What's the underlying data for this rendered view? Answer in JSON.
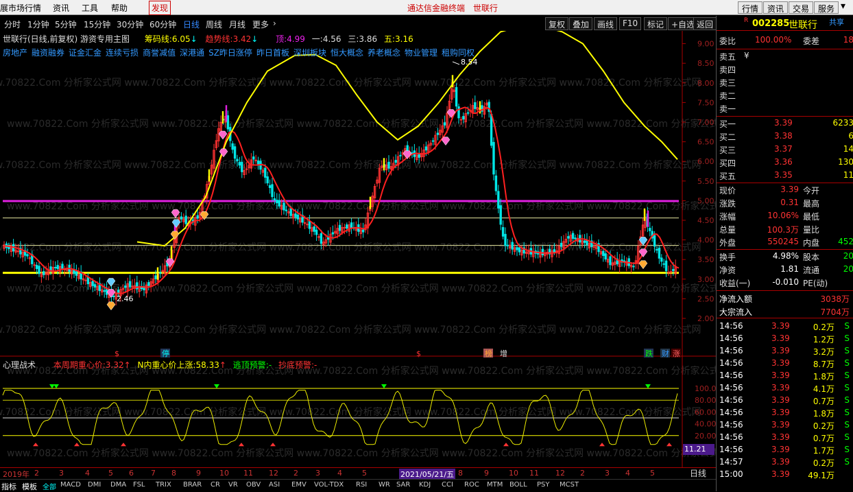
{
  "menu": {
    "items": [
      "展市场行情",
      "资讯",
      "工具",
      "帮助"
    ],
    "discover": "发现",
    "center_links": [
      "通达信金融终端",
      "世联行"
    ],
    "right_buttons": [
      "行情",
      "资讯",
      "交易",
      "服务"
    ]
  },
  "periods": {
    "items": [
      "分时",
      "1分钟",
      "5分钟",
      "15分钟",
      "30分钟",
      "60分钟",
      "日线",
      "周线",
      "月线",
      "更多"
    ],
    "active": "日线",
    "arrow": "›"
  },
  "toolbar": {
    "buttons": [
      "复权",
      "叠加",
      "画线",
      "F10",
      "标记",
      "+自选",
      "返回"
    ]
  },
  "main_chart": {
    "title": "世联行(日线,前复权)",
    "subtitle": "游资专用主图",
    "chip_line_label": "筹码线:",
    "chip_line_value": "6.05",
    "chip_arrow": "↓",
    "trend_line_label": "趋势线:",
    "trend_line_value": "3.42",
    "trend_arrow": "↓",
    "top_label": "顶:",
    "top_value": "4.99",
    "l1_label": "一:",
    "l1_value": "4.56",
    "l3_label": "三:",
    "l3_value": "3.86",
    "l5_label": "五:",
    "l5_value": "3.16",
    "tags": [
      "房地产",
      "融资融券",
      "证金汇金",
      "连续亏损",
      "商誉减值",
      "深港通",
      "SZ昨日涨停",
      "昨日首板",
      "深圳板块",
      "恒大概念",
      "养老概念",
      "物业管理",
      "租购同权"
    ],
    "price_axis": [
      "9.50",
      "9.00",
      "8.50",
      "8.00",
      "7.50",
      "7.00",
      "6.50",
      "6.00",
      "5.50",
      "5.00",
      "4.50",
      "4.00",
      "3.50",
      "3.00",
      "2.50",
      "2.00"
    ],
    "high_label": "8.54",
    "low_label": "2.46",
    "markers": [
      "$",
      "$",
      "榜",
      "增",
      "$",
      "跌",
      "财",
      "涨"
    ],
    "watermark": "www.70822.Com 分析家公式网"
  },
  "sub_chart": {
    "title": "心理战术",
    "week_label": "本周期重心价:",
    "week_value": "3.32",
    "week_arrow": "↑",
    "n_label": "N内重心价上涨:",
    "n_value": "58.33",
    "n_arrow": "↑",
    "escape_label": "逃顶预警:",
    "escape_value": "-",
    "bottom_label": "抄底预警:",
    "bottom_value": "-",
    "axis": [
      "100.0",
      "80.00",
      "60.00",
      "40.00",
      "20.00"
    ],
    "current": "11.21"
  },
  "date_axis": {
    "labels": [
      "2019年",
      "2",
      "3",
      "4",
      "5",
      "6",
      "7",
      "8",
      "9",
      "10",
      "11",
      "12",
      "2",
      "3",
      "4",
      "5",
      "2021/05/21/五",
      "8",
      "9",
      "10",
      "11",
      "12",
      "2",
      "3",
      "4",
      "5"
    ],
    "timeframe": "日线"
  },
  "indicator_tabs": {
    "prefix": [
      "指标",
      "模板"
    ],
    "items": [
      "全部",
      "MACD",
      "DMI",
      "DMA",
      "FSL",
      "TRIX",
      "BRAR",
      "CR",
      "VR",
      "OBV",
      "ASI",
      "EMV",
      "VOL-TDX",
      "RSI",
      "WR",
      "SAR",
      "KDJ",
      "CCI",
      "ROC",
      "MTM",
      "BOLL",
      "PSY",
      "MCST"
    ],
    "active": "全部"
  },
  "quote": {
    "badge": "R",
    "code": "002285",
    "name": "世联行",
    "share": "共享",
    "weibi_label": "委比",
    "weibi": "100.00%",
    "weicha_label": "委差",
    "weicha": "18",
    "sell": [
      {
        "label": "卖五",
        "price": "¥",
        "vol": ""
      },
      {
        "label": "卖四",
        "price": "",
        "vol": ""
      },
      {
        "label": "卖三",
        "price": "",
        "vol": ""
      },
      {
        "label": "卖二",
        "price": "",
        "vol": ""
      },
      {
        "label": "卖一",
        "price": "",
        "vol": ""
      }
    ],
    "buy": [
      {
        "label": "买一",
        "price": "3.39",
        "vol": "6233"
      },
      {
        "label": "买二",
        "price": "3.38",
        "vol": "6"
      },
      {
        "label": "买三",
        "price": "3.37",
        "vol": "14"
      },
      {
        "label": "买四",
        "price": "3.36",
        "vol": "130"
      },
      {
        "label": "买五",
        "price": "3.35",
        "vol": "11"
      }
    ],
    "stats": [
      {
        "l": "现价",
        "v": "3.39",
        "l2": "今开",
        "v2": ""
      },
      {
        "l": "涨跌",
        "v": "0.31",
        "l2": "最高",
        "v2": ""
      },
      {
        "l": "涨幅",
        "v": "10.06%",
        "l2": "最低",
        "v2": ""
      },
      {
        "l": "总量",
        "v": "100.3万",
        "l2": "量比",
        "v2": ""
      },
      {
        "l": "外盘",
        "v": "550245",
        "l2": "内盘",
        "v2": "452"
      }
    ],
    "stats2": [
      {
        "l": "换手",
        "v": "4.98%",
        "l2": "股本",
        "v2": "20"
      },
      {
        "l": "净资",
        "v": "1.81",
        "l2": "流通",
        "v2": "20"
      },
      {
        "l": "收益(一)",
        "v": "-0.010",
        "l2": "PE(动)",
        "v2": ""
      }
    ],
    "flow": [
      {
        "l": "净流入额",
        "v": "3038万"
      },
      {
        "l": "大宗流入",
        "v": "7704万"
      }
    ],
    "ticks": [
      {
        "t": "14:56",
        "p": "3.39",
        "v": "0.2万",
        "s": "S"
      },
      {
        "t": "14:56",
        "p": "3.39",
        "v": "1.2万",
        "s": "S"
      },
      {
        "t": "14:56",
        "p": "3.39",
        "v": "3.2万",
        "s": "S"
      },
      {
        "t": "14:56",
        "p": "3.39",
        "v": "8.7万",
        "s": "S"
      },
      {
        "t": "14:56",
        "p": "3.39",
        "v": "1.8万",
        "s": "S"
      },
      {
        "t": "14:56",
        "p": "3.39",
        "v": "4.1万",
        "s": "S"
      },
      {
        "t": "14:56",
        "p": "3.39",
        "v": "0.7万",
        "s": "S"
      },
      {
        "t": "14:56",
        "p": "3.39",
        "v": "1.8万",
        "s": "S"
      },
      {
        "t": "14:56",
        "p": "3.39",
        "v": "0.2万",
        "s": "S"
      },
      {
        "t": "14:56",
        "p": "3.39",
        "v": "0.7万",
        "s": "S"
      },
      {
        "t": "14:56",
        "p": "3.39",
        "v": "1.7万",
        "s": "S"
      },
      {
        "t": "14:57",
        "p": "3.39",
        "v": "0.2万",
        "s": "S"
      },
      {
        "t": "15:00",
        "p": "3.39",
        "v": "49.1万",
        "s": ""
      }
    ]
  },
  "colors": {
    "up": "#ff3232",
    "down": "#00e6e6",
    "yellow": "#ffff00",
    "magenta": "#e020e0",
    "red_line": "#ff2020",
    "green": "#00dd00"
  }
}
